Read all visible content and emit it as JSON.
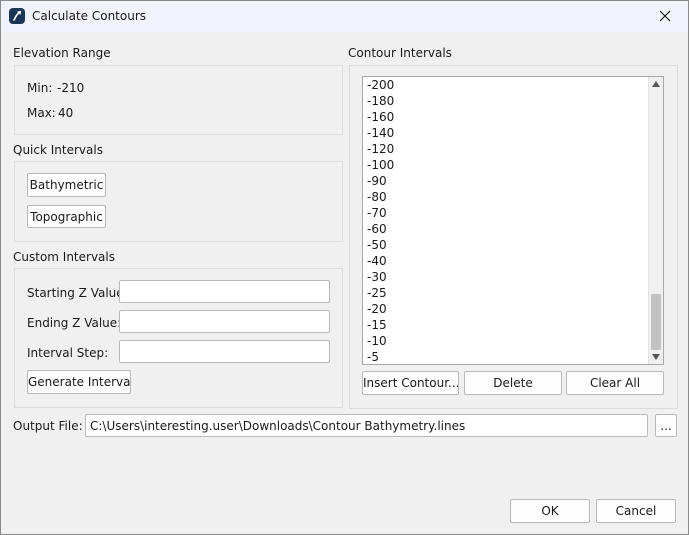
{
  "window": {
    "title": "Calculate Contours"
  },
  "elevation_range": {
    "heading": "Elevation Range",
    "min_label": "Min:",
    "min_value": "-210",
    "max_label": "Max:",
    "max_value": "40"
  },
  "quick_intervals": {
    "heading": "Quick Intervals",
    "bathymetric_label": "Bathymetric",
    "topographic_label": "Topographic"
  },
  "custom_intervals": {
    "heading": "Custom Intervals",
    "starting_label": "Starting Z Value:",
    "starting_value": "",
    "ending_label": "Ending Z Value:",
    "ending_value": "",
    "step_label": "Interval Step:",
    "step_value": "",
    "generate_label": "Generate Intervals"
  },
  "contour_intervals": {
    "heading": "Contour Intervals",
    "items": [
      "-200",
      "-180",
      "-160",
      "-140",
      "-120",
      "-100",
      "-90",
      "-80",
      "-70",
      "-60",
      "-50",
      "-40",
      "-30",
      "-25",
      "-20",
      "-15",
      "-10",
      "-5"
    ],
    "scroll_position": 1.0,
    "insert_label": "Insert Contour...",
    "delete_label": "Delete",
    "clear_label": "Clear All"
  },
  "output": {
    "label": "Output File:",
    "path": "C:\\Users\\interesting.user\\Downloads\\Contour Bathymetry.lines",
    "browse_label": "..."
  },
  "dialog_buttons": {
    "ok_label": "OK",
    "cancel_label": "Cancel"
  },
  "icons": {
    "app": "app-icon",
    "close": "close-icon",
    "scroll_up": "scroll-up-arrow-icon",
    "scroll_down": "scroll-down-arrow-icon"
  },
  "colors": {
    "titlebar": "#f0f3f9",
    "dialog_background": "#f0f0f0",
    "app_icon": "#1b3557"
  }
}
